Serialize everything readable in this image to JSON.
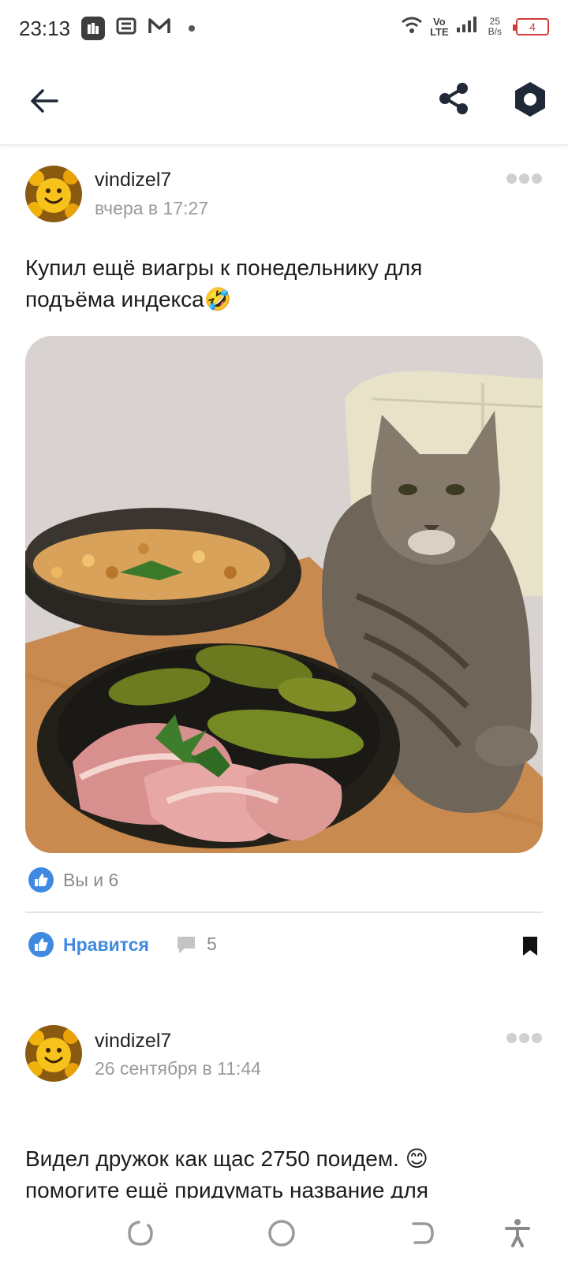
{
  "status_bar": {
    "time": "23:13",
    "network_type_top": "Vo",
    "network_type_bottom": "LTE",
    "speed_value": "25",
    "speed_unit": "B/s",
    "battery": "4"
  },
  "colors": {
    "accent": "#3f8ae0",
    "text_secondary": "#9a9a9a",
    "battery_low": "#d43b3b",
    "icon_dark": "#1f2937"
  },
  "posts": [
    {
      "author": "vindizel7",
      "time": "вчера в 17:27",
      "text_line1": "Купил ещё виагры к понедельнику для",
      "text_line2": "подъёма индекса🤣",
      "likes_summary": "Вы и 6",
      "like_label": "Нравится",
      "comments_count": "5"
    },
    {
      "author": "vindizel7",
      "time": "26 сентября в 11:44",
      "text_line1": "Видел дружок как щас 2750 поидем. 😊",
      "text_line2": "помогите ещё придумать название для"
    }
  ]
}
